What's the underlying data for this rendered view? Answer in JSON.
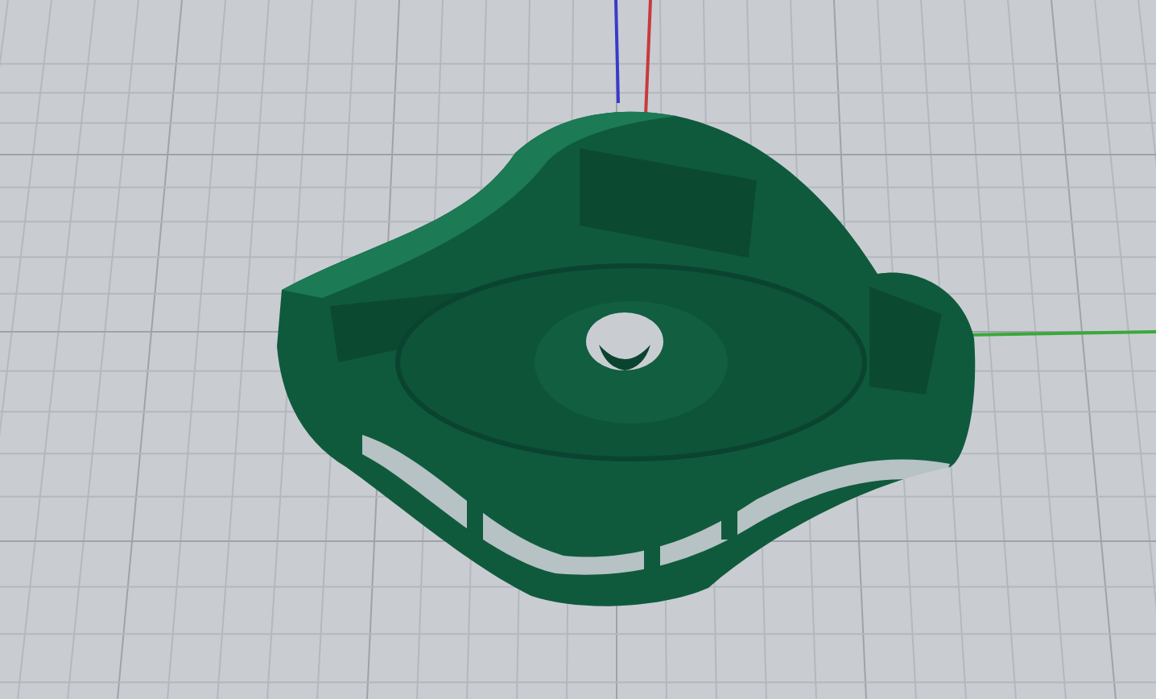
{
  "viewport": {
    "axes": [
      {
        "kind": "x",
        "color": "#c83a3a"
      },
      {
        "kind": "y",
        "color": "#3aa83a"
      },
      {
        "kind": "z",
        "color": "#3a3ac8"
      }
    ]
  }
}
